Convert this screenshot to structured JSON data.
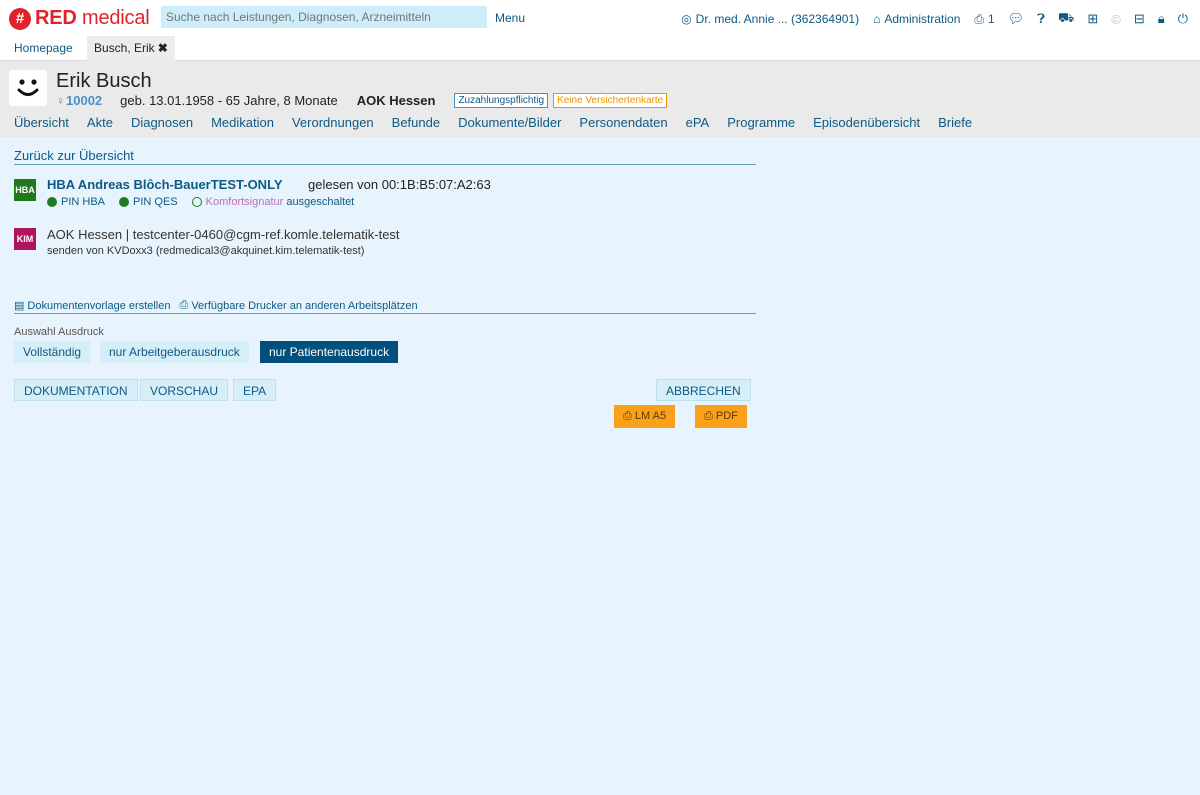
{
  "topbar": {
    "logo_symbol": "#",
    "logo_bold": "RED",
    "logo_text": " medical",
    "search_placeholder": "Suche nach Leistungen, Diagnosen, Arzneimitteln",
    "menu_label": "Menu",
    "user_label": "Dr. med. Annie ... (362364901)",
    "admin_label": "Administration",
    "printer_count": "1"
  },
  "tabs": {
    "home": "Homepage",
    "active": "Busch, Erik",
    "close_glyph": "✖"
  },
  "patient": {
    "avatar_glyph": "ᵕ",
    "name": "Erik Busch",
    "gender_glyph": "♀",
    "id": "10002",
    "dob": "geb. 13.01.1958 - 65 Jahre, 8 Monate",
    "insurer": "AOK Hessen",
    "badge_copay": "Zuzahlungspflichtig",
    "badge_card": "Keine Versichertenkarte"
  },
  "nav": [
    "Übersicht",
    "Akte",
    "Diagnosen",
    "Medikation",
    "Verordnungen",
    "Befunde",
    "Dokumente/Bilder",
    "Personendaten",
    "ePA",
    "Programme",
    "Episodenübersicht",
    "Briefe"
  ],
  "main": {
    "back_label": "Zurück zur Übersicht",
    "hba": {
      "icon_label": "HBA",
      "title": "HBA Andreas Blôch-BauerTEST-ONLY",
      "read_from": "gelesen von 00:1B:B5:07:A2:63",
      "pin_hba": "PIN HBA",
      "pin_qes": "PIN QES",
      "komfort": "Komfortsignatur",
      "komfort_state": "ausgeschaltet"
    },
    "kim": {
      "icon_label": "KIM",
      "title": "AOK Hessen | testcenter-0460@cgm-ref.komle.telematik-test",
      "sender": "senden von KVDoxx3 (redmedical3@akquinet.kim.telematik-test)"
    },
    "links": {
      "template": "Dokumentenvorlage erstellen",
      "printers": "Verfügbare Drucker an anderen Arbeitsplätzen"
    },
    "auswahl_label": "Auswahl Ausdruck",
    "auswahl_options": [
      "Vollständig",
      "nur Arbeitgeberausdruck",
      "nur Patientenausdruck"
    ],
    "auswahl_selected": "nur Patientenausdruck",
    "buttons": {
      "doku": "DOKUMENTATION",
      "vorschau": "VORSCHAU",
      "epa": "EPA",
      "abbrechen": "ABBRECHEN",
      "lm_a5": "LM A5",
      "pdf": "PDF"
    }
  },
  "colors": {
    "brand_red": "#e0232b",
    "link_blue": "#0d5a85",
    "selected_dark": "#004f7c",
    "orange": "#f9a11b",
    "background": "#e8f4fd"
  }
}
